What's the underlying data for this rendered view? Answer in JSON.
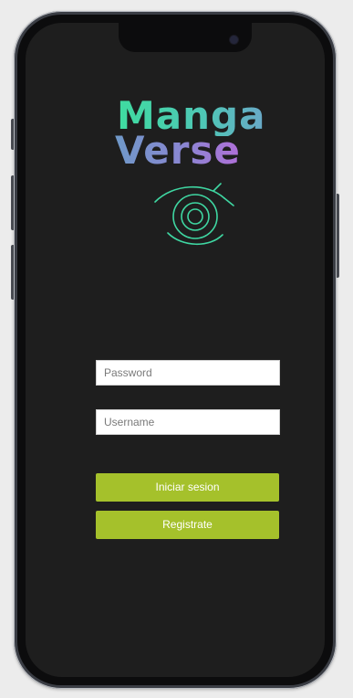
{
  "logo": {
    "line1": "Manga",
    "line2": "Verse",
    "icon": "eye-icon"
  },
  "form": {
    "password_placeholder": "Password",
    "username_placeholder": "Username",
    "login_label": "Iniciar sesion",
    "register_label": "Registrate"
  },
  "colors": {
    "screen_bg": "#1e1e1e",
    "button_bg": "#a5c12b",
    "logo_teal": "#3fdca0",
    "logo_purple": "#b06fd8",
    "eye_stroke": "#3fd7a2"
  }
}
